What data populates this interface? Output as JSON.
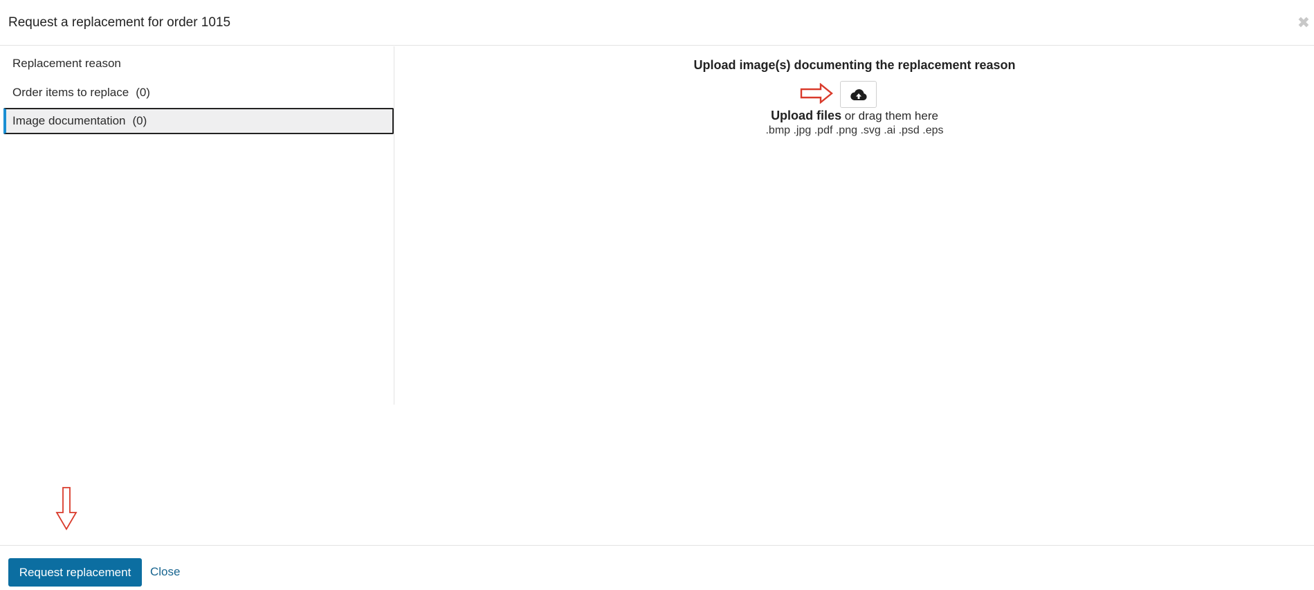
{
  "dialog": {
    "title": "Request a replacement for order 1015",
    "close_icon": "close-icon"
  },
  "sidebar": {
    "items": [
      {
        "label": "Replacement reason",
        "count": ""
      },
      {
        "label": "Order items to replace",
        "count": "(0)"
      },
      {
        "label": "Image documentation",
        "count": "(0)",
        "active": true
      }
    ]
  },
  "upload": {
    "heading": "Upload image(s) documenting the replacement reason",
    "button_icon": "cloud-upload-icon",
    "upload_files_label": "Upload files",
    "drag_text": " or drag them here",
    "formats": ".bmp .jpg .pdf .png .svg .ai .psd .eps"
  },
  "annotations": {
    "right_arrow_icon": "red-arrow-right-icon",
    "down_arrow_icon": "red-arrow-down-icon",
    "arrow_color": "#d93a2b"
  },
  "footer": {
    "primary_label": "Request replacement",
    "close_label": "Close"
  },
  "colors": {
    "primary": "#0c6ea1",
    "active_accent": "#1a8fd3",
    "link": "#17648f"
  }
}
